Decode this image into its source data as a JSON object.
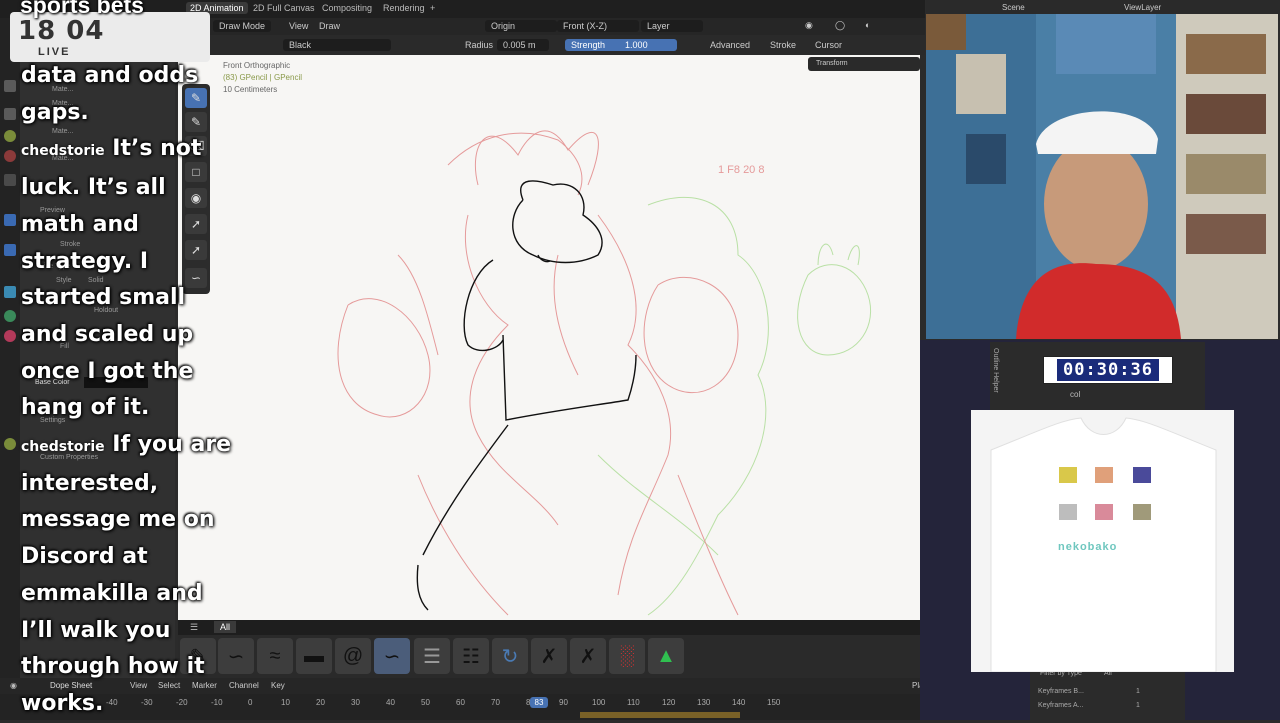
{
  "topbar": {
    "tabs": [
      "2D Animation",
      "2D Full Canvas",
      "Compositing",
      "Rendering"
    ],
    "add_tab": "+",
    "scene": "Scene",
    "viewlayer": "ViewLayer"
  },
  "header": {
    "mode": "Draw Mode",
    "view": "View",
    "draw": "Draw",
    "origin": "Origin",
    "axis": "Front (X-Z)",
    "layer": "Layer"
  },
  "brush_settings": {
    "material": "Black",
    "radius_label": "Radius",
    "radius_value": "0.005 m",
    "strength_label": "Strength",
    "strength_value": "1.000",
    "advanced": "Advanced",
    "stroke": "Stroke",
    "cursor": "Cursor"
  },
  "viewport": {
    "view_name": "Front Orthographic",
    "object": "(83) GPencil | GPencil",
    "scale": "10 Centimeters",
    "transform_tab": "Transform",
    "sketch_note": "1 F8   20 8"
  },
  "left_panel": {
    "materials": [
      "Mate...",
      "Mate...",
      "Mate...",
      "Mate..."
    ],
    "preview": "Preview",
    "stroke": "Stroke",
    "line_type": "Line Type",
    "style": "Style",
    "style_value": "Solid",
    "holdout": "Holdout",
    "fill": "Fill",
    "base_color": "Base Color",
    "settings": "Settings",
    "custom_properties": "Custom Properties"
  },
  "brush_shelf": {
    "tab_label": "All",
    "brushes": [
      "pencil",
      "ink",
      "marker",
      "flat",
      "at",
      "script",
      "hatch",
      "scribble",
      "stroke",
      "loop",
      "eraser",
      "eraser2",
      "red",
      "green"
    ]
  },
  "timeline": {
    "editor": "Dope Sheet",
    "menus": [
      "View",
      "Select",
      "Marker",
      "Channel",
      "Key"
    ],
    "playhead_label": "Playhead",
    "current_frame": "83",
    "ticks": [
      "-40",
      "-30",
      "-20",
      "-10",
      "0",
      "10",
      "20",
      "30",
      "40",
      "50",
      "60",
      "70",
      "80",
      "90",
      "100",
      "110",
      "120",
      "130",
      "140",
      "150"
    ]
  },
  "right_lower": {
    "timer": "00:30:36",
    "collection": "col",
    "filter_by_type": "Filter by Type",
    "filter_value": "All",
    "keyframes_before": "Keyframes B...",
    "keyframes_after": "Keyframes A...",
    "kf_value1": "1",
    "kf_value2": "1",
    "outliner_label": "Outline Helper"
  },
  "merch": {
    "brand": "nekobako"
  },
  "overlay": {
    "ticker_text": "sports bets",
    "live_time": "18 04",
    "live_label": "LIVE",
    "chat_line1": "data and odds",
    "chat_line2": "gaps.",
    "user1": "chedstorie",
    "chat_line3": "It’s not",
    "chat_line4": "luck. It’s all",
    "chat_line5": "math and",
    "chat_line6": "strategy. I",
    "chat_line7": "started small",
    "chat_line8": "and scaled up",
    "chat_line9": "once I got the",
    "chat_line10": "hang of it.",
    "user2": "chedstorie",
    "chat_line11": "If you are",
    "chat_line12": "interested,",
    "chat_line13": "message me on",
    "chat_line14": "Discord at",
    "chat_line15": "emmakilla and",
    "chat_line16": "I’ll walk you",
    "chat_line17": "through how it",
    "chat_line18": "works."
  },
  "colors": {
    "accent": "#4772b3",
    "sketch_red": "#e59a9a",
    "sketch_green": "#b9e0a5",
    "ink": "#111111"
  }
}
